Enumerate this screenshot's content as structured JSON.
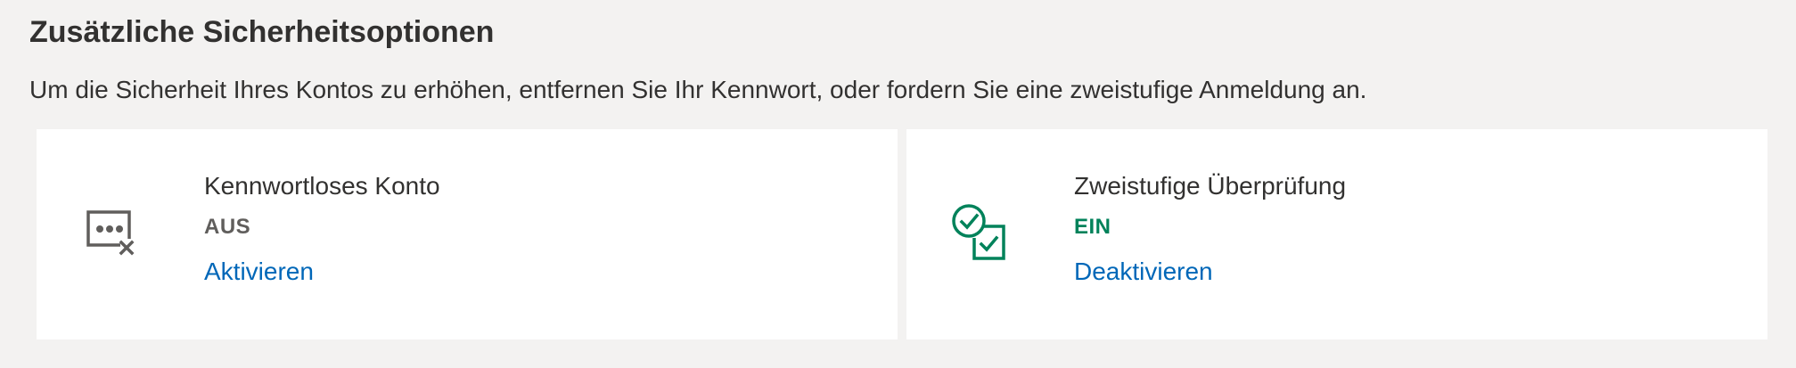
{
  "section": {
    "title": "Zusätzliche Sicherheitsoptionen",
    "description": "Um die Sicherheit Ihres Kontos zu erhöhen, entfernen Sie Ihr Kennwort, oder fordern Sie eine zweistufige Anmeldung an."
  },
  "cards": [
    {
      "title": "Kennwortloses Konto",
      "status": "AUS",
      "status_color": "#605e5c",
      "action_label": "Aktivieren",
      "icon": "password-off-icon"
    },
    {
      "title": "Zweistufige Überprüfung",
      "status": "EIN",
      "status_color": "#00825a",
      "action_label": "Deaktivieren",
      "icon": "two-step-verification-icon"
    }
  ],
  "colors": {
    "page_background": "#f3f2f1",
    "card_background": "#ffffff",
    "text": "#323130",
    "link": "#0067b8",
    "icon_gray": "#605e5c",
    "accent_green": "#00825a"
  }
}
